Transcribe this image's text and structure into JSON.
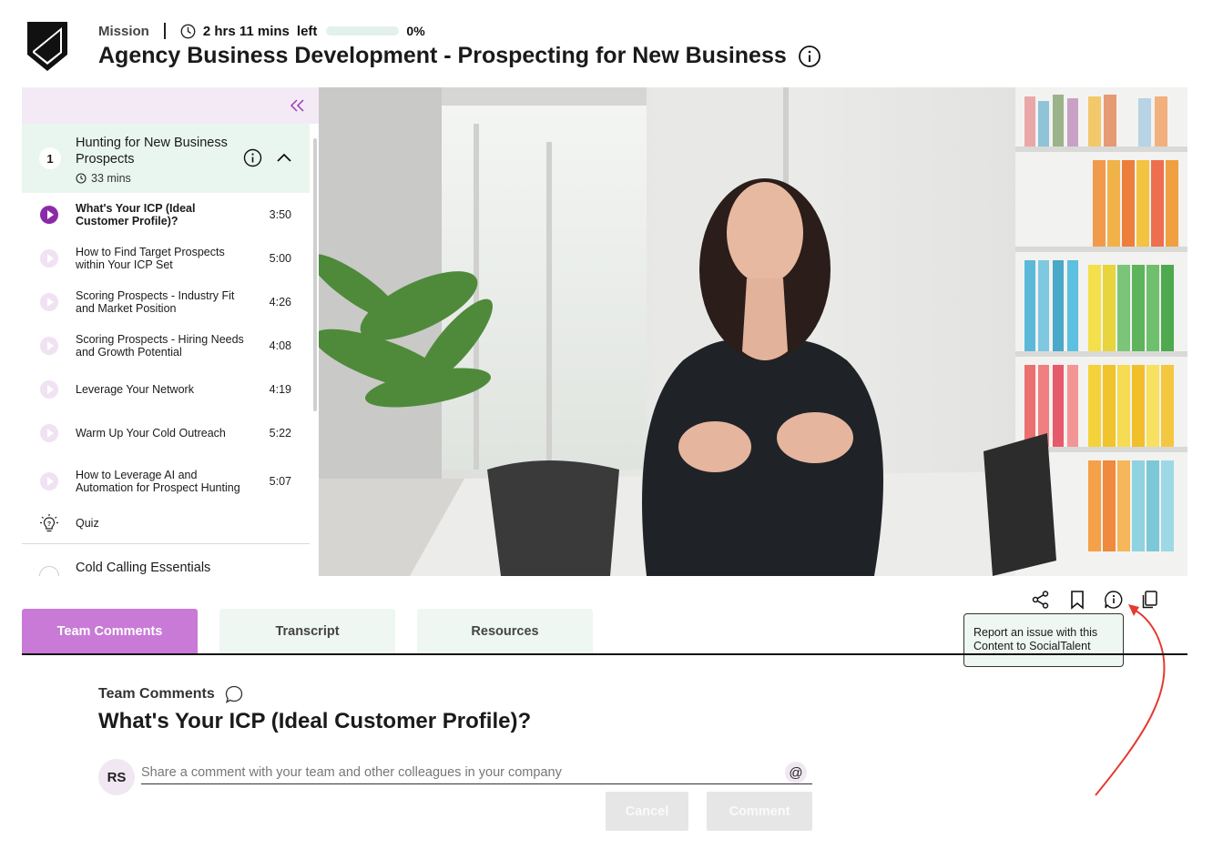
{
  "header": {
    "mission_label": "Mission",
    "time_left": "2 hrs 11 mins",
    "left_label": "left",
    "progress_percent": "0%",
    "progress_value": 0,
    "course_title": "Agency Business Development - Prospecting for New Business"
  },
  "sidebar": {
    "module": {
      "number": "1",
      "title": "Hunting for New Business Prospects",
      "duration": "33 mins"
    },
    "lessons": [
      {
        "title": "What's Your ICP (Ideal Customer Profile)?",
        "duration": "3:50",
        "active": true
      },
      {
        "title": "How to Find Target Prospects within Your ICP Set",
        "duration": "5:00"
      },
      {
        "title": "Scoring Prospects - Industry Fit and Market Position",
        "duration": "4:26"
      },
      {
        "title": "Scoring Prospects - Hiring Needs and Growth Potential",
        "duration": "4:08"
      },
      {
        "title": "Leverage Your Network",
        "duration": "4:19"
      },
      {
        "title": "Warm Up Your Cold Outreach",
        "duration": "5:22"
      },
      {
        "title": "How to Leverage AI and Automation for Prospect Hunting",
        "duration": "5:07"
      }
    ],
    "quiz_label": "Quiz",
    "next_module_title": "Cold Calling Essentials"
  },
  "tooltip": {
    "text": "Report an issue with this Content to SocialTalent"
  },
  "tabs": [
    {
      "label": "Team Comments",
      "active": true
    },
    {
      "label": "Transcript"
    },
    {
      "label": "Resources"
    }
  ],
  "comments": {
    "section_label": "Team Comments",
    "lesson_title": "What's Your ICP (Ideal Customer Profile)?",
    "avatar_initials": "RS",
    "input_placeholder": "Share a comment with your team and other colleagues in your company",
    "mention_symbol": "@",
    "cancel_label": "Cancel",
    "submit_label": "Comment"
  },
  "colors": {
    "accent_purple": "#8b2aa8",
    "active_tab": "#c87ad6",
    "module_bg": "#e9f6ef",
    "arrow_red": "#e53a2f"
  },
  "icons": [
    "shield-logo-icon",
    "clock-icon",
    "info-icon",
    "collapse-icon",
    "chevron-up-icon",
    "play-icon",
    "quiz-bulb-icon",
    "share-icon",
    "bookmark-icon",
    "report-info-icon",
    "copy-icon",
    "speech-bubble-icon"
  ]
}
